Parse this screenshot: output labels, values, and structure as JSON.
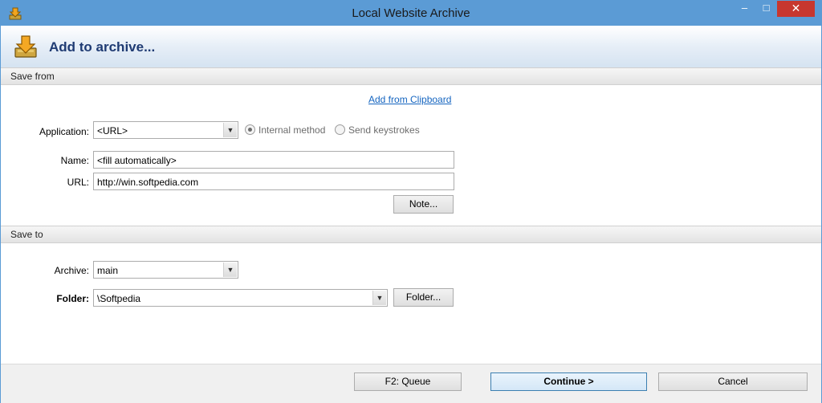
{
  "window": {
    "title": "Local Website Archive",
    "min": "–",
    "max": "□",
    "close": "✕"
  },
  "header": {
    "title": "Add to archive..."
  },
  "save_from": {
    "section_label": "Save from",
    "clipboard_link": "Add from Clipboard",
    "application_label": "Application:",
    "application_value": "<URL>",
    "radio_internal": "Internal method",
    "radio_keystrokes": "Send keystrokes",
    "name_label": "Name:",
    "name_value": "<fill automatically>",
    "url_label": "URL:",
    "url_value": "http://win.softpedia.com",
    "note_button": "Note..."
  },
  "save_to": {
    "section_label": "Save to",
    "archive_label": "Archive:",
    "archive_value": "main",
    "folder_label": "Folder:",
    "folder_value": "\\Softpedia",
    "folder_button": "Folder..."
  },
  "footer": {
    "queue_button": "F2: Queue",
    "continue_button": "Continue >",
    "cancel_button": "Cancel"
  },
  "colors": {
    "titlebar": "#5b9bd5",
    "close": "#c7372f",
    "header_title": "#1f3b73",
    "link": "#1565c0"
  },
  "icons": {
    "app_icon": "download-arrow-icon",
    "header_icon": "download-arrow-icon"
  }
}
